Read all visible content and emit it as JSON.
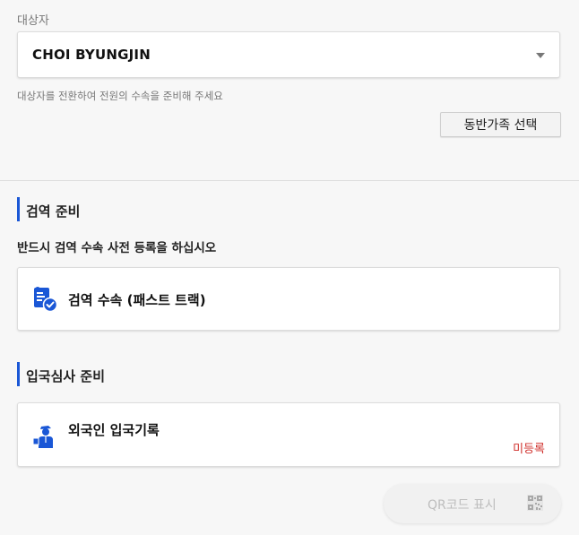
{
  "target": {
    "label": "대상자",
    "selected_value": "CHOI BYUNGJIN",
    "hint": "대상자를 전환하여 전원의 수속을 준비해 주세요",
    "companion_button": "동반가족 선택"
  },
  "quarantine": {
    "title": "검역 준비",
    "subtitle": "반드시 검역 수속 사전 등록을 하십시오",
    "card_title": "검역 수속 (패스트 트랙)",
    "icon": "document-check-icon"
  },
  "immigration": {
    "title": "입국심사 준비",
    "card_title": "외국인 입국기록",
    "status": "미등록",
    "icon": "immigration-officer-icon"
  },
  "qr_button": {
    "label": "QR코드 표시",
    "icon": "qr-code-icon"
  },
  "colors": {
    "accent": "#1a57d6",
    "status_red": "#d0302c",
    "disabled_text": "#bdbdbd"
  }
}
